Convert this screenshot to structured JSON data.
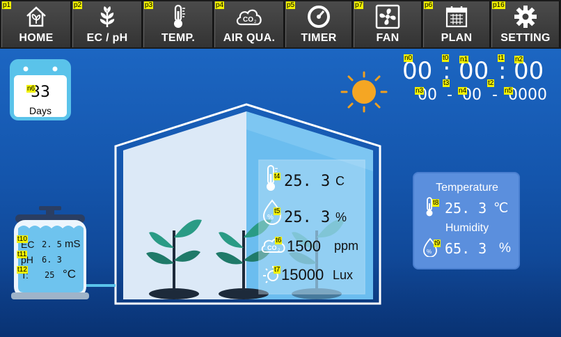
{
  "nav": [
    {
      "tag": "p1",
      "label": "HOME",
      "icon": "home-leaf-icon"
    },
    {
      "tag": "p2",
      "label": "EC / pH",
      "icon": "leaf-icon"
    },
    {
      "tag": "p3",
      "label": "TEMP.",
      "icon": "thermometer-icon"
    },
    {
      "tag": "p4",
      "label": "AIR QUA.",
      "icon": "co2-cloud-icon"
    },
    {
      "tag": "p5",
      "label": "TIMER",
      "icon": "timer-gauge-icon"
    },
    {
      "tag": "p7",
      "label": "FAN",
      "icon": "fan-icon"
    },
    {
      "tag": "p6",
      "label": "PLAN",
      "icon": "calendar-icon"
    },
    {
      "tag": "p16",
      "label": "SETTING",
      "icon": "gear-icon"
    }
  ],
  "days": {
    "tag": "n6",
    "value": "33",
    "unit": "Days"
  },
  "clock": {
    "hours": "00",
    "minutes": "00",
    "seconds": "00",
    "sep1": ":",
    "sep2": ":",
    "tags": {
      "h": "n0",
      "sep1": "t0",
      "m": "n1",
      "sep2": "t1",
      "s": "n2"
    }
  },
  "date": {
    "part1": "00",
    "part2": "00",
    "part3": "0000",
    "dash1": "-",
    "dash2": "-",
    "tags": {
      "p1": "n3",
      "d1": "t3",
      "p2": "n4",
      "d2": "t2",
      "p3": "n5"
    }
  },
  "greenhouse": {
    "temperature": {
      "tag": "t4",
      "value": "25. 3",
      "unit": "C"
    },
    "humidity": {
      "tag": "t5",
      "value": "25. 3",
      "unit": "%"
    },
    "co2": {
      "tag": "t6",
      "value": "1500",
      "unit": "ppm"
    },
    "light": {
      "tag": "t7",
      "value": "15000",
      "unit": "Lux"
    }
  },
  "climate": {
    "temperature_label": "Temperature",
    "temperature": {
      "tag": "t8",
      "value": "25. 3",
      "unit": "℃"
    },
    "humidity_label": "Humidity",
    "humidity": {
      "tag": "t9",
      "value": "65. 3",
      "unit": "%"
    }
  },
  "tank": {
    "ec": {
      "tag": "t10",
      "prefix": "EC",
      "value": "2. 5",
      "unit": "mS"
    },
    "ph": {
      "tag": "t11",
      "prefix": "pH",
      "value": "6. 3"
    },
    "temp": {
      "tag": "t12",
      "prefix": "T:",
      "value": "25",
      "unit": "°C"
    }
  },
  "colors": {
    "sun": "#f5a623",
    "sun_rays": "#f0a020",
    "accent": "#4aa8e8",
    "panel": "#5b8fdd"
  }
}
